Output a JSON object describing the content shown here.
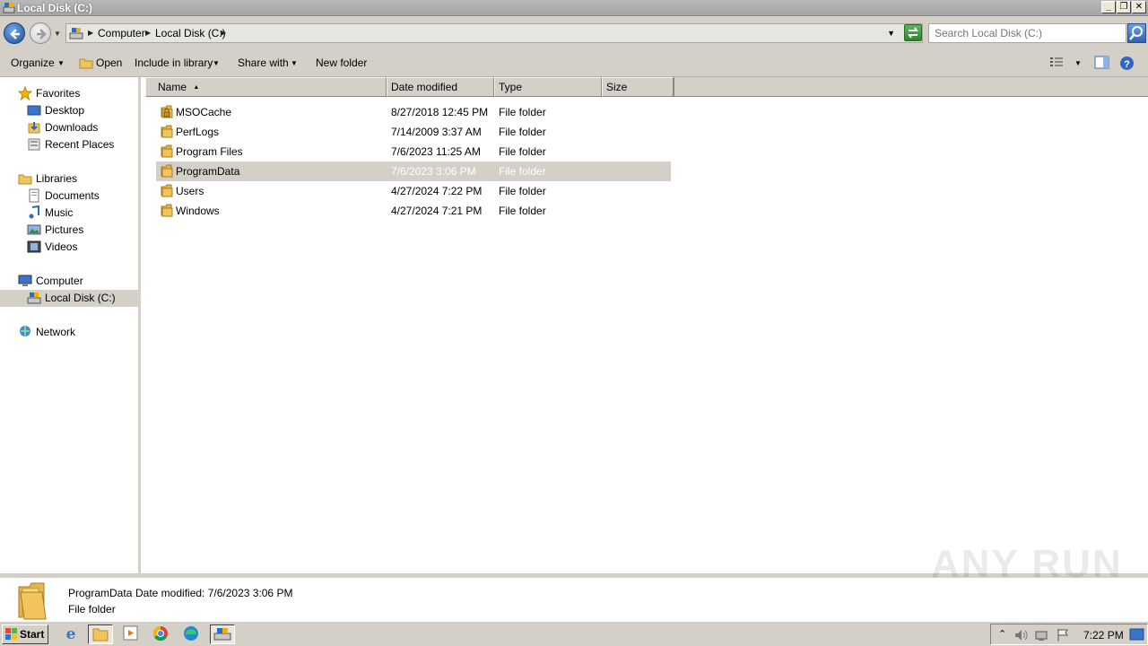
{
  "window": {
    "title": "Local Disk (C:)"
  },
  "address": {
    "crumbs": [
      "Computer",
      "Local Disk (C:)"
    ],
    "search_placeholder": "Search Local Disk (C:)"
  },
  "toolbar": {
    "organize": "Organize",
    "open": "Open",
    "include_in_library": "Include in library",
    "share_with": "Share with",
    "new_folder": "New folder"
  },
  "nav": {
    "favorites": "Favorites",
    "desktop": "Desktop",
    "downloads": "Downloads",
    "recent_places": "Recent Places",
    "libraries": "Libraries",
    "documents": "Documents",
    "music": "Music",
    "pictures": "Pictures",
    "videos": "Videos",
    "computer": "Computer",
    "local_disk": "Local Disk (C:)",
    "network": "Network"
  },
  "columns": {
    "name": "Name",
    "date_modified": "Date modified",
    "type": "Type",
    "size": "Size"
  },
  "files": [
    {
      "name": "MSOCache",
      "date": "8/27/2018 12:45 PM",
      "type": "File folder",
      "locked": true
    },
    {
      "name": "PerfLogs",
      "date": "7/14/2009 3:37 AM",
      "type": "File folder"
    },
    {
      "name": "Program Files",
      "date": "7/6/2023 11:25 AM",
      "type": "File folder"
    },
    {
      "name": "ProgramData",
      "date": "7/6/2023 3:06 PM",
      "type": "File folder",
      "selected": true
    },
    {
      "name": "Users",
      "date": "4/27/2024 7:22 PM",
      "type": "File folder"
    },
    {
      "name": "Windows",
      "date": "4/27/2024 7:21 PM",
      "type": "File folder"
    }
  ],
  "details": {
    "name": "ProgramData",
    "modified": "Date modified: 7/6/2023 3:06 PM",
    "type": "File folder"
  },
  "watermark": "ANY RUN",
  "taskbar": {
    "start": "Start",
    "clock": "7:22 PM"
  },
  "colors": {
    "selection": "#d4d0c8",
    "chrome": "#d4d0c8",
    "title_bar": "#a5a5a5"
  }
}
